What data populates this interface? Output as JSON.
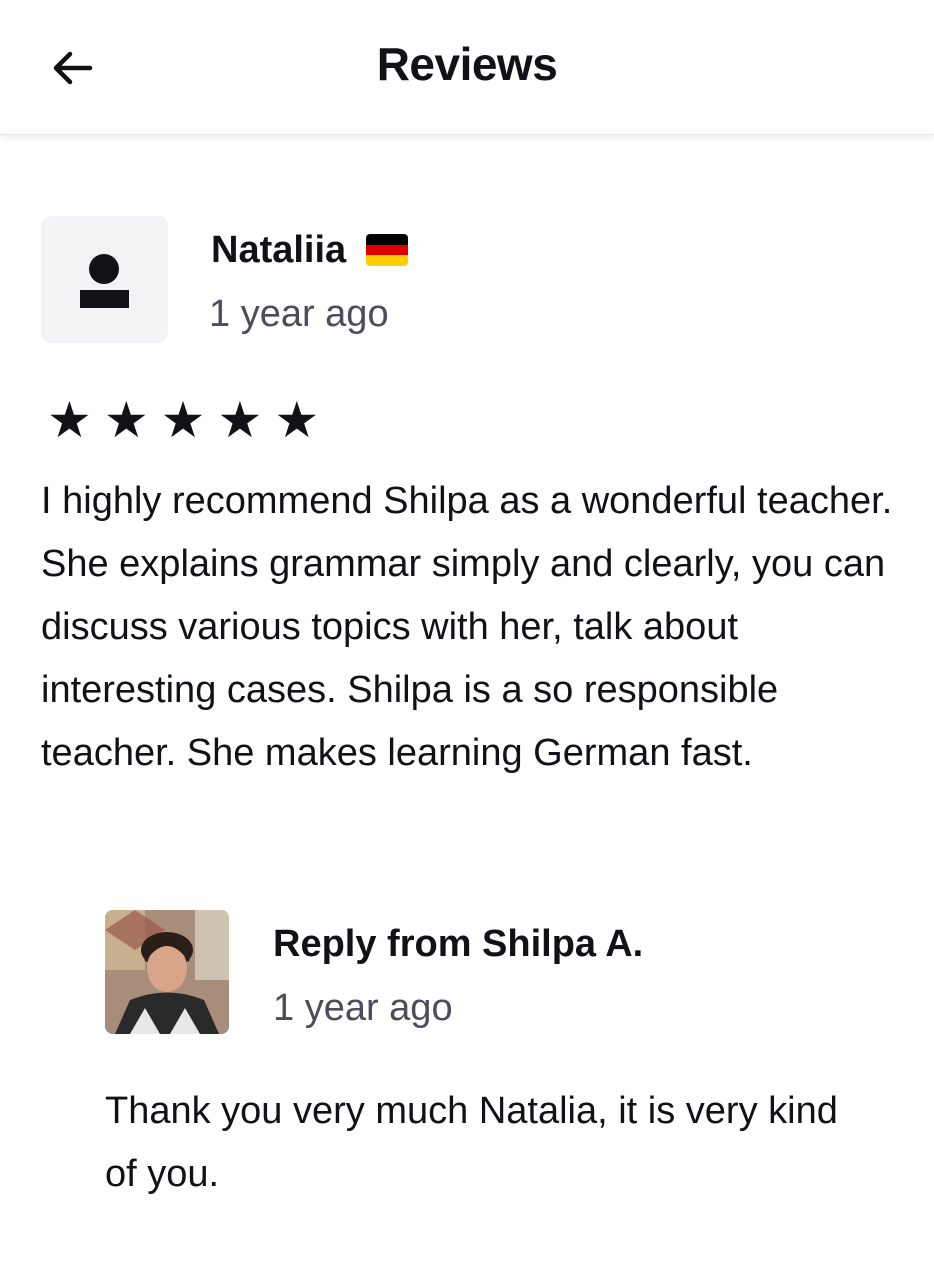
{
  "header": {
    "title": "Reviews",
    "back_icon": "arrow-left-icon"
  },
  "review": {
    "reviewer_name": "Nataliia",
    "country_flag": "germany-flag-icon",
    "flag_colors": [
      "#000000",
      "#dd0000",
      "#ffce00"
    ],
    "date": "1 year ago",
    "rating": 5,
    "stars": [
      "★",
      "★",
      "★",
      "★",
      "★"
    ],
    "text": "I highly recommend Shilpa as a wonderful teacher. She explains grammar simply and clearly, you can discuss various topics with her, talk about interesting cases.  Shilpa is a so responsible teacher.  She makes learning German fast."
  },
  "reply": {
    "title": "Reply from Shilpa A.",
    "date": "1 year ago",
    "text": "Thank you very much Natalia, it is very kind of you."
  }
}
